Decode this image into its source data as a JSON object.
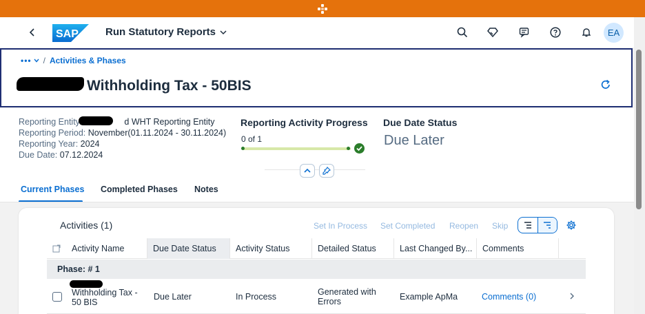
{
  "shell": {
    "app_title": "Run Statutory Reports",
    "logo_text": "SAP",
    "avatar_initials": "EA",
    "icons": [
      "search-icon",
      "diamond-icon",
      "chat-icon",
      "help-icon",
      "bell-icon"
    ]
  },
  "header": {
    "breadcrumb_dots": "•••",
    "breadcrumb_sep": "/",
    "breadcrumb_link": "Activities & Phases",
    "title": "Withholding Tax - 50BIS"
  },
  "meta": {
    "entity_label": "Reporting Entity:",
    "entity_value": "d WHT Reporting Entity",
    "period_label": "Reporting Period:",
    "period_value": "November(01.11.2024 - 30.11.2024)",
    "year_label": "Reporting Year:",
    "year_value": "2024",
    "due_label": "Due Date:",
    "due_value": "07.12.2024"
  },
  "progress": {
    "title": "Reporting Activity Progress",
    "text": "0 of 1",
    "fraction": 0
  },
  "due_status": {
    "title": "Due Date Status",
    "value": "Due Later"
  },
  "tabs": [
    {
      "label": "Current Phases"
    },
    {
      "label": "Completed Phases"
    },
    {
      "label": "Notes"
    }
  ],
  "table": {
    "title": "Activities (1)",
    "actions": [
      "Set In Process",
      "Set Completed",
      "Reopen",
      "Skip"
    ],
    "columns": [
      "Activity Name",
      "Due Date Status",
      "Activity Status",
      "Detailed Status",
      "Last Changed By...",
      "Comments"
    ],
    "group_label": "Phase: # 1",
    "rows": [
      {
        "activity_line1": "Withholding Tax -",
        "activity_line2": "50 BIS",
        "due_status": "Due Later",
        "activity_status": "In Process",
        "detailed_line1": "Generated with",
        "detailed_line2": "Errors",
        "last_changed": "Example ApMa",
        "comments": "Comments (0)"
      }
    ]
  },
  "colors": {
    "topbar": "#e5720c",
    "accent": "#0a6ed1",
    "success": "#2b7d2b"
  }
}
